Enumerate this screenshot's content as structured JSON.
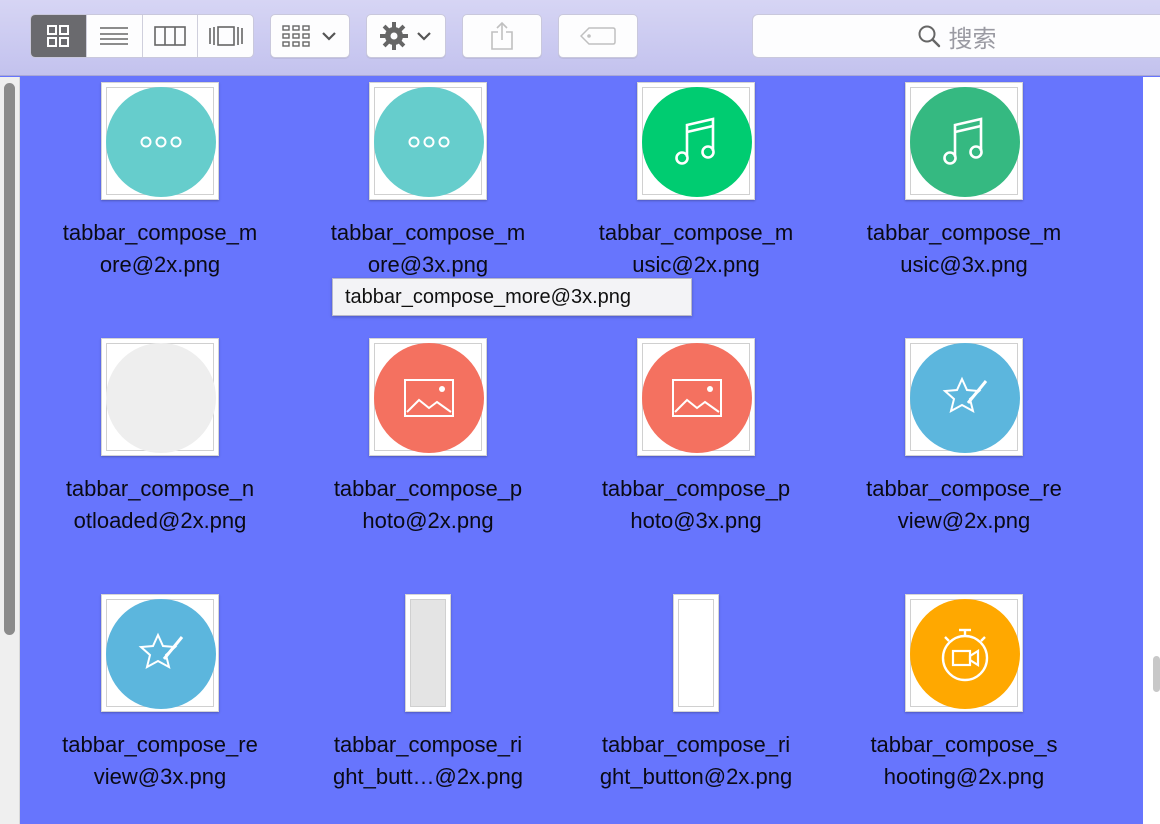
{
  "toolbar": {
    "search_placeholder": "搜索"
  },
  "files": [
    {
      "line1": "tabbar_compose_m",
      "line2": "ore@2x.png",
      "icon": "more-dots-icon",
      "color": "#66cdcc"
    },
    {
      "line1": "tabbar_compose_m",
      "line2": "ore@3x.png",
      "icon": "more-dots-icon",
      "color": "#66cdcc"
    },
    {
      "line1": "tabbar_compose_m",
      "line2": "usic@2x.png",
      "icon": "music-note-icon",
      "color": "#00cc71"
    },
    {
      "line1": "tabbar_compose_m",
      "line2": "usic@3x.png",
      "icon": "music-note-icon",
      "color": "#35b981"
    },
    {
      "line1": "tabbar_compose_n",
      "line2": "otloaded@2x.png",
      "icon": "blank-circle",
      "color": "#eeeeee"
    },
    {
      "line1": "tabbar_compose_p",
      "line2": "hoto@2x.png",
      "icon": "photo-icon",
      "color": "#f47160"
    },
    {
      "line1": "tabbar_compose_p",
      "line2": "hoto@3x.png",
      "icon": "photo-icon",
      "color": "#f47160"
    },
    {
      "line1": "tabbar_compose_re",
      "line2": "view@2x.png",
      "icon": "star-pen-icon",
      "color": "#5cb6dd"
    },
    {
      "line1": "tabbar_compose_re",
      "line2": "view@3x.png",
      "icon": "star-pen-icon",
      "color": "#5cb6dd"
    },
    {
      "line1": "tabbar_compose_ri",
      "line2": "ght_butt…@2x.png",
      "icon": "button-bar",
      "color": "#e4e4e4"
    },
    {
      "line1": "tabbar_compose_ri",
      "line2": "ght_button@2x.png",
      "icon": "button-bar",
      "color": "#ffffff"
    },
    {
      "line1": "tabbar_compose_s",
      "line2": "hooting@2x.png",
      "icon": "video-timer-icon",
      "color": "#ffa800"
    }
  ],
  "tooltip": "tabbar_compose_more@3x.png"
}
